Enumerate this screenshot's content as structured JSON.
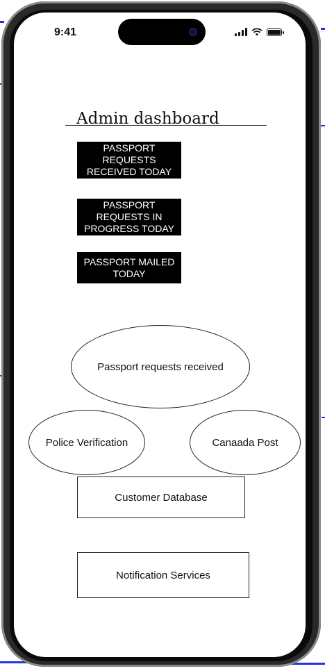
{
  "status_bar": {
    "time": "9:41"
  },
  "dashboard": {
    "title": "Admin dashboard"
  },
  "stats": [
    {
      "label": "PASSPORT REQUESTS RECEIVED TODAY"
    },
    {
      "label": "PASSPORT REQUESTS IN PROGRESS TODAY"
    },
    {
      "label": "PASSPORT MAILED TODAY"
    }
  ],
  "flow": {
    "center": "Passport requests received",
    "left": "Police Verification",
    "right": "Canaada Post"
  },
  "services": {
    "database": "Customer Database",
    "notifications": "Notification Services"
  },
  "icons": [
    "signal-icon",
    "wifi-icon",
    "battery-icon"
  ],
  "colors": {
    "box_bg": "#000000",
    "box_text": "#ffffff",
    "artifact": "#2233dd"
  }
}
